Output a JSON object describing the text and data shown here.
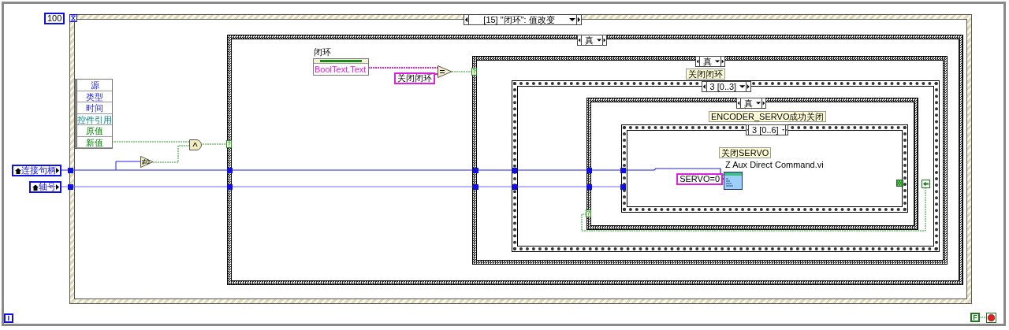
{
  "while_loop": {
    "timeout_constant": "100",
    "iteration_label": "i",
    "stop_constant": "F"
  },
  "event_structure": {
    "selector": "[15] \"闭环\": 值改变"
  },
  "event_data_node": {
    "items": [
      {
        "label": "源",
        "kind": "info"
      },
      {
        "label": "类型",
        "kind": "info"
      },
      {
        "label": "时间",
        "kind": "info"
      },
      {
        "label": "控件引用",
        "kind": "reference"
      },
      {
        "label": "原值",
        "kind": "value"
      },
      {
        "label": "新值",
        "kind": "value"
      }
    ]
  },
  "controls": [
    {
      "label": "连接句柄"
    },
    {
      "label": "轴号"
    }
  ],
  "property_node": {
    "label": "闭环",
    "property": "BoolText.Text"
  },
  "compare_constant": "关闭闭环",
  "case_outer": {
    "selector": "真"
  },
  "case_middle": {
    "selector": "真",
    "label": "关闭闭环"
  },
  "sequence_outer": {
    "selector": "3 [0..3]"
  },
  "case_inner": {
    "selector": "真",
    "label": "ENCODER_SERVO成功关闭"
  },
  "sequence_inner": {
    "selector": "3 [0..6]",
    "label": "关闭SERVO",
    "subvi_name": "Z Aux Direct Command.vi",
    "constant": "SERVO=0"
  }
}
